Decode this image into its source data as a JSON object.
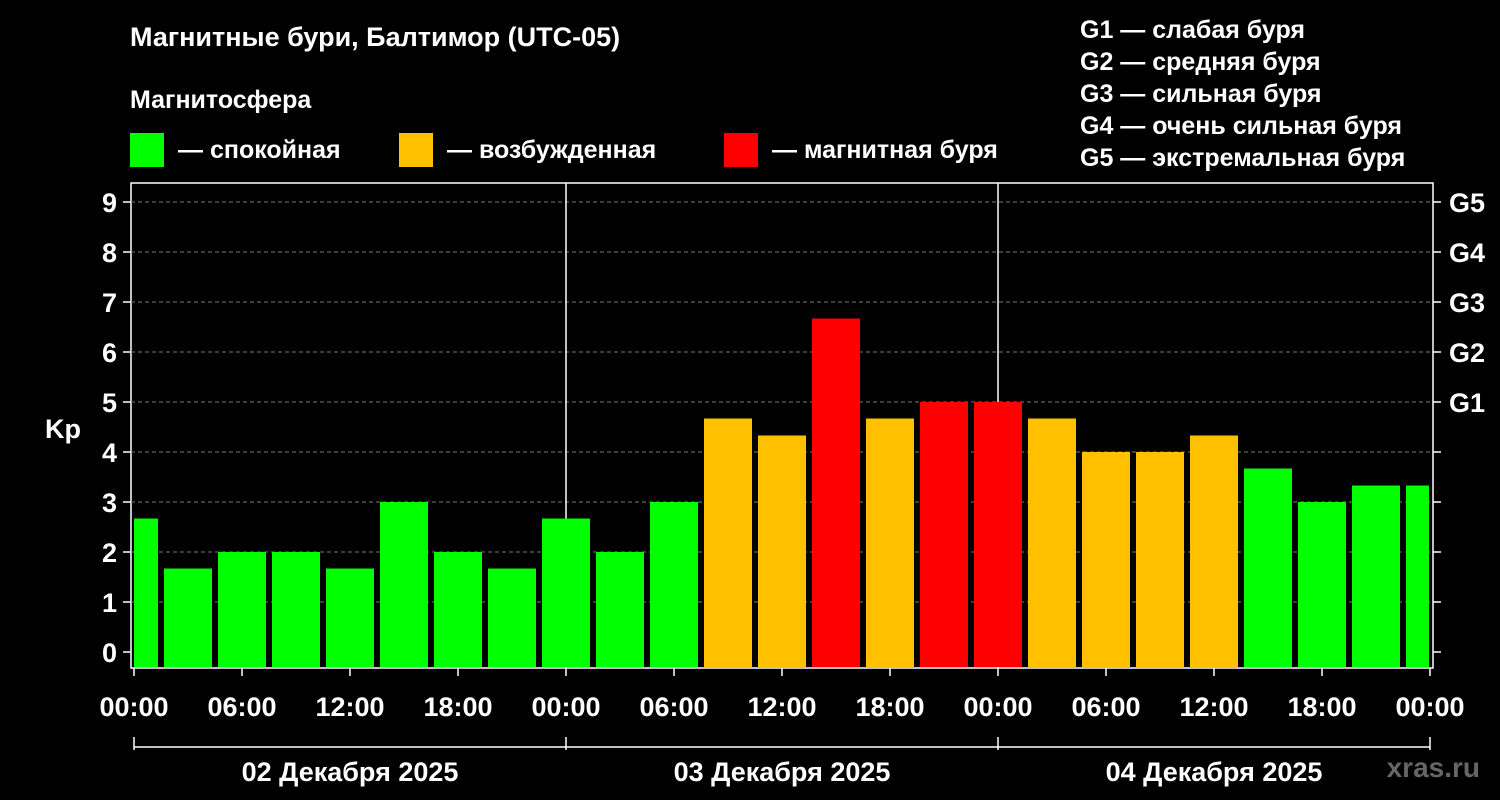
{
  "chart_data": {
    "type": "bar",
    "title": "Магнитные бури, Балтимор (UTC-05)",
    "subtitle": "Магнитосфера",
    "ylabel": "Kp",
    "ylim": [
      0,
      9
    ],
    "yticks": [
      "0",
      "1",
      "2",
      "3",
      "4",
      "5",
      "6",
      "7",
      "8",
      "9"
    ],
    "right_axis": [
      {
        "kp": 5,
        "label": "G1"
      },
      {
        "kp": 6,
        "label": "G2"
      },
      {
        "kp": 7,
        "label": "G3"
      },
      {
        "kp": 8,
        "label": "G4"
      },
      {
        "kp": 9,
        "label": "G5"
      }
    ],
    "legend": [
      {
        "label": "— спокойная",
        "color": "#00ff00"
      },
      {
        "label": "— возбужденная",
        "color": "#ffc000"
      },
      {
        "label": "— магнитная буря",
        "color": "#ff0000"
      }
    ],
    "g_scale": [
      "G1 — слабая буря",
      "G2 — средняя буря",
      "G3 — сильная буря",
      "G4 — очень сильная буря",
      "G5 — экстремальная буря"
    ],
    "xtick_labels": [
      "00:00",
      "06:00",
      "12:00",
      "18:00",
      "00:00",
      "06:00",
      "12:00",
      "18:00",
      "00:00",
      "06:00",
      "12:00",
      "18:00",
      "00:00"
    ],
    "days": [
      "02 Декабря 2025",
      "03 Декабря 2025",
      "04 Декабря 2025"
    ],
    "x_hours": [
      0,
      3,
      6,
      9,
      12,
      15,
      18,
      21,
      24,
      27,
      30,
      33,
      36,
      39,
      42,
      45,
      48,
      51,
      54,
      57,
      60,
      63,
      66,
      69,
      72
    ],
    "values": [
      2.67,
      1.67,
      2.0,
      2.0,
      1.67,
      3.0,
      2.0,
      1.67,
      2.67,
      2.0,
      3.0,
      4.67,
      4.33,
      6.67,
      4.67,
      5.0,
      5.0,
      4.67,
      4.0,
      4.0,
      4.33,
      3.67,
      3.0,
      3.33,
      3.33
    ],
    "colors": {
      "quiet": "#00ff00",
      "active": "#ffc000",
      "storm": "#ff0000"
    },
    "grid": true
  },
  "watermark": "xras.ru"
}
